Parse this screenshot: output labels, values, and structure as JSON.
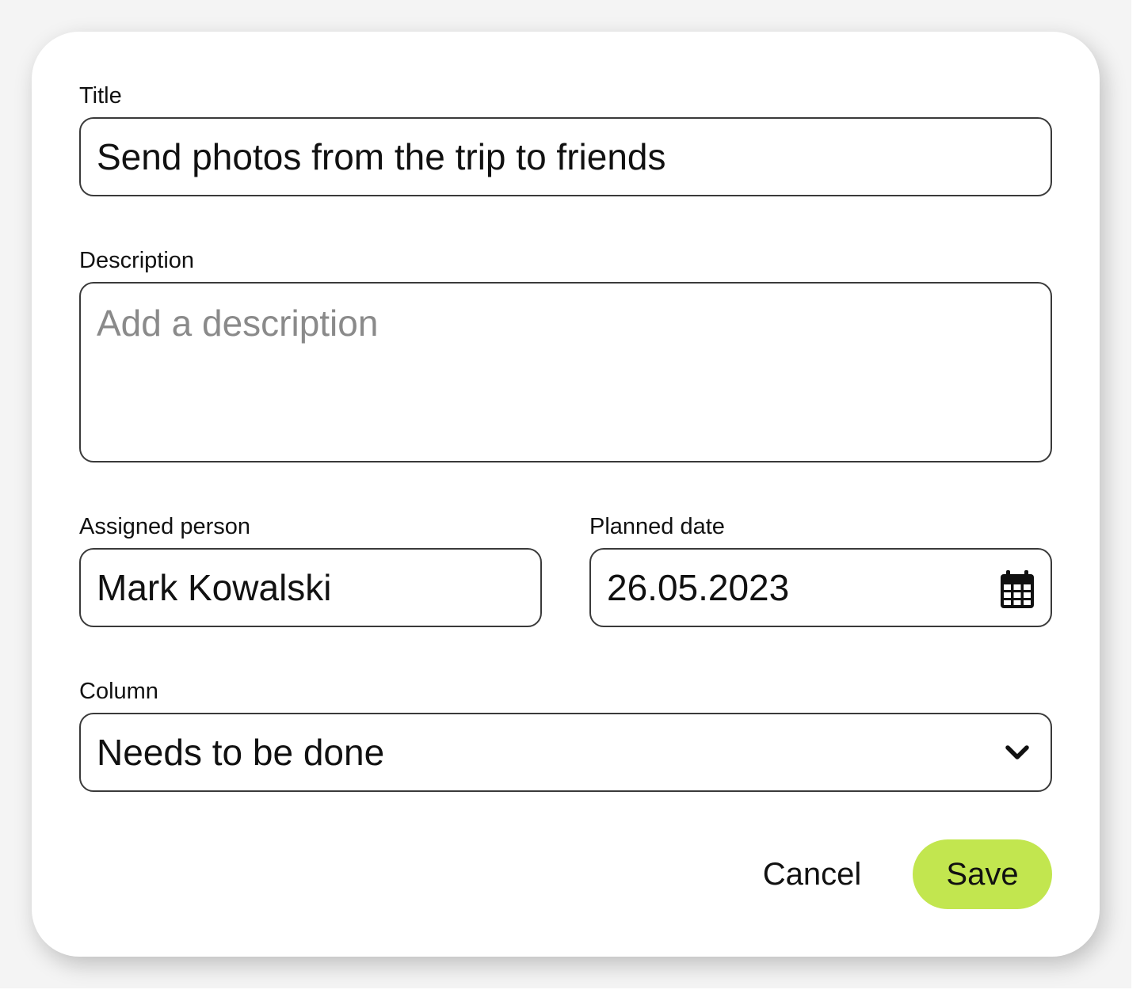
{
  "form": {
    "title_label": "Title",
    "title_value": "Send photos from the trip to friends",
    "description_label": "Description",
    "description_value": "",
    "description_placeholder": "Add a description",
    "assignee_label": "Assigned person",
    "assignee_value": "Mark Kowalski",
    "date_label": "Planned date",
    "date_value": "26.05.2023",
    "date_icon": "calendar-icon",
    "column_label": "Column",
    "column_value": "Needs to be done",
    "column_icon": "chevron-down-icon"
  },
  "actions": {
    "cancel_label": "Cancel",
    "save_label": "Save"
  },
  "colors": {
    "accent": "#c2e64f",
    "border": "#3a3a3a",
    "placeholder": "#8a8a8a",
    "backdrop": "#f4f4f4"
  }
}
